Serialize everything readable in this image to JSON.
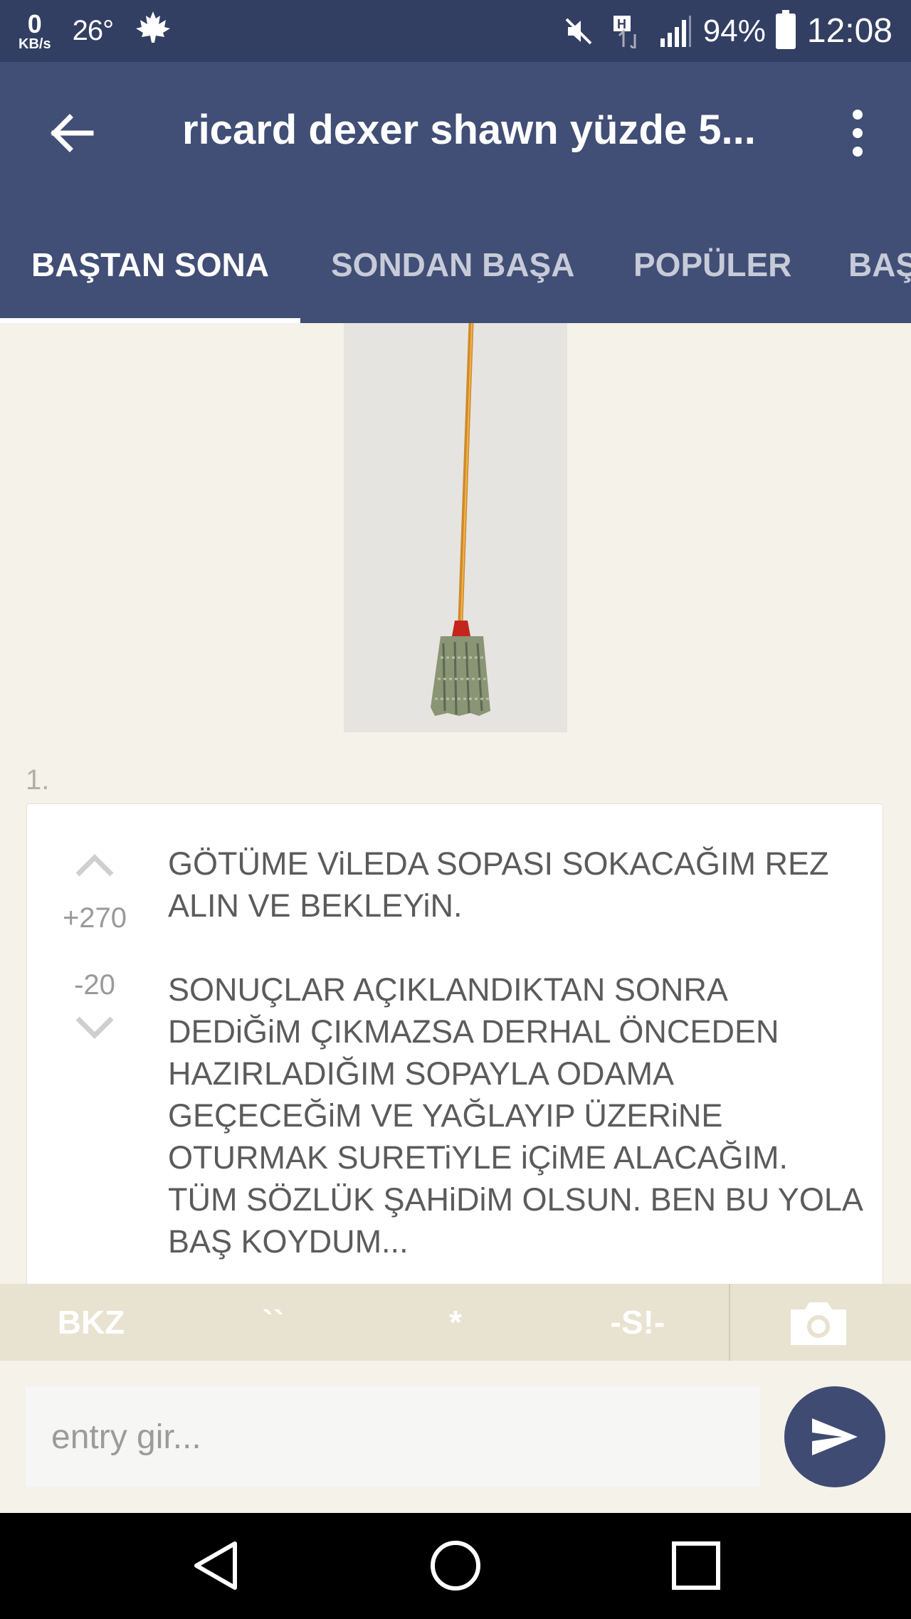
{
  "status_bar": {
    "speed_value": "0",
    "speed_unit": "KB/s",
    "temperature": "26°",
    "battery_percent": "94%",
    "time": "12:08"
  },
  "app_bar": {
    "title": "ricard dexer shawn yüzde 5..."
  },
  "tabs": [
    {
      "label": "BAŞTAN SONA",
      "active": true
    },
    {
      "label": "SONDAN BAŞA",
      "active": false
    },
    {
      "label": "POPÜLER",
      "active": false
    },
    {
      "label": "BAŞ",
      "active": false
    }
  ],
  "entry": {
    "number": "1.",
    "upvotes": "+270",
    "downvotes": "-20",
    "paragraph1": "GÖTÜME ViLEDA SOPASI SOKACAĞIM REZ ALIN VE BEKLEYiN.",
    "paragraph2": "SONUÇLAR AÇIKLANDIKTAN SONRA DEDiĞiM ÇIKMAZSA DERHAL ÖNCEDEN HAZIRLADIĞIM SOPAYLA ODAMA GEÇECEĞiM VE YAĞLAYIP ÜZERiNE OTURMAK SURETiYLE iÇiME ALACAĞIM. TÜM SÖZLÜK ŞAHiDiM OLSUN. BEN BU YOLA BAŞ KOYDUM..."
  },
  "format_toolbar": {
    "bkz": "BKZ",
    "backticks": "``",
    "asterisk": "*",
    "spoiler": "-S!-"
  },
  "composer": {
    "placeholder": "entry gir..."
  },
  "colors": {
    "status_bar": "#323f63",
    "app_bar": "#414e76",
    "background": "#f4f2e9",
    "send_button": "#3f4b72"
  }
}
